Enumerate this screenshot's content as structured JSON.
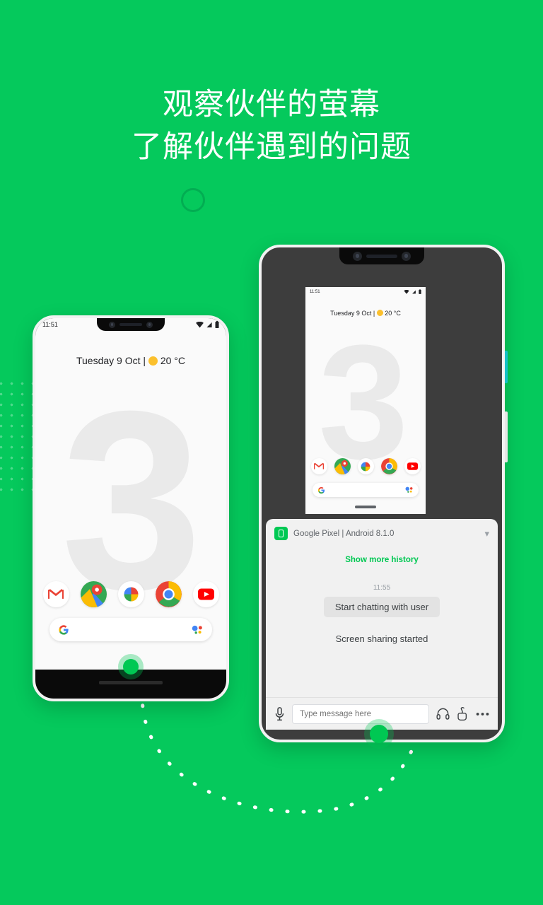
{
  "theme": {
    "background": "#05c95c",
    "accent": "#00c853",
    "headline_color": "#ffffff",
    "dark_screen": "#3d3d3d"
  },
  "headline": {
    "line1": "观察伙伴的萤幕",
    "line2": "了解伙伴遇到的问题"
  },
  "phone_left": {
    "label": "helper-device",
    "status": {
      "time": "11:51",
      "wifi": "wifi-icon",
      "signal": "signal-icon",
      "battery": "battery-icon"
    },
    "wallpaper_glyph": "3",
    "date_widget": {
      "date": "Tuesday 9 Oct",
      "separator": "|",
      "weather_icon": "sun-cloud-icon",
      "temperature": "20 °C"
    },
    "dock": [
      {
        "name": "gmail",
        "label": "Gmail"
      },
      {
        "name": "maps",
        "label": "Maps"
      },
      {
        "name": "photos",
        "label": "Photos"
      },
      {
        "name": "chrome",
        "label": "Chrome"
      },
      {
        "name": "youtube",
        "label": "YouTube"
      }
    ],
    "search": {
      "logo": "google-g-icon",
      "assistant": "assistant-icon"
    }
  },
  "phone_right": {
    "label": "technician-device",
    "mirror": {
      "status": {
        "time": "11:51"
      },
      "wallpaper_glyph": "3",
      "date_widget": {
        "date": "Tuesday 9 Oct",
        "separator": "|",
        "weather_icon": "sun-cloud-icon",
        "temperature": "20 °C"
      },
      "dock": [
        {
          "name": "gmail",
          "label": "Gmail"
        },
        {
          "name": "maps",
          "label": "Maps"
        },
        {
          "name": "photos",
          "label": "Photos"
        },
        {
          "name": "chrome",
          "label": "Chrome"
        },
        {
          "name": "youtube",
          "label": "YouTube"
        }
      ]
    },
    "chat": {
      "device_title": "Google Pixel | Android 8.1.0",
      "collapse_icon": "chevron-down-icon",
      "show_more": "Show more history",
      "timestamp": "11:55",
      "bubble": "Start chatting with user",
      "system_message": "Screen sharing started"
    },
    "toolbar": {
      "mic_icon": "microphone-icon",
      "input_placeholder": "Type message here",
      "input_value": "",
      "headset_icon": "headset-icon",
      "gesture_icon": "pointer-hand-icon",
      "more_icon": "more-horizontal-icon"
    }
  }
}
